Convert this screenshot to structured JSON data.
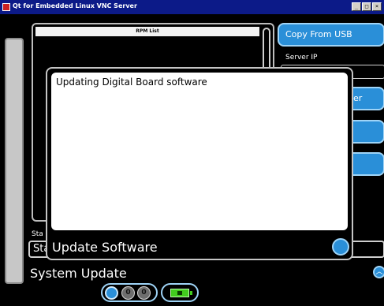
{
  "window": {
    "title": "Qt for Embedded Linux VNC Server",
    "buttons": [
      "_",
      "□",
      "×"
    ]
  },
  "rpm_list": {
    "header": "RPM List"
  },
  "right_panel": {
    "copy_from_usb_label": "Copy From USB",
    "server_ip_label": "Server IP",
    "server_ip_value": "",
    "server_button_label": "er"
  },
  "status": {
    "label_partial": "Sta",
    "box_text_partial": "Sta"
  },
  "section_title": "System Update",
  "control_buttons": {
    "left_glyphs": [
      "0",
      "0"
    ]
  },
  "dialog": {
    "message": "Updating Digital Board software",
    "title": "Update Software"
  },
  "colors": {
    "accent_blue": "#2a8fd8",
    "battery_green": "#42cc1e",
    "titlebar_blue": "#0c1a88"
  }
}
